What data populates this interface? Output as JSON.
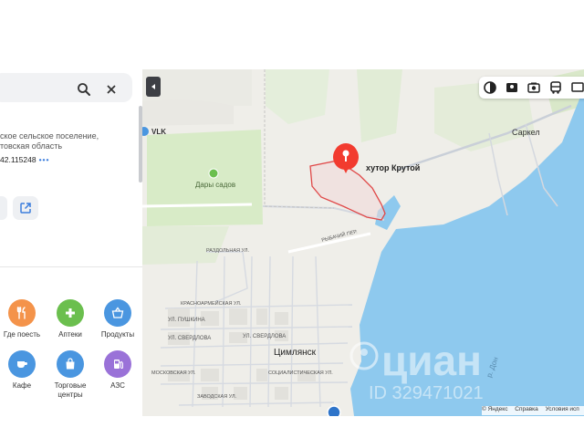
{
  "search": {
    "value": ""
  },
  "place": {
    "address_line1": "ское сельское поселение,",
    "address_line2": "товская область",
    "coords": "42.115248",
    "coords_more": "•••"
  },
  "categories": [
    {
      "label": "Где поесть",
      "icon": "fork-knife-icon",
      "color": "#f4934a"
    },
    {
      "label": "Аптеки",
      "icon": "plus-icon",
      "color": "#6bbf4e"
    },
    {
      "label": "Продукты",
      "icon": "basket-icon",
      "color": "#4a96e0"
    },
    {
      "label": "Кафе",
      "icon": "cup-icon",
      "color": "#4a96e0"
    },
    {
      "label": "Торговые центры",
      "icon": "bag-icon",
      "color": "#4a96e0"
    },
    {
      "label": "АЗС",
      "icon": "fuel-icon",
      "color": "#9a72d8"
    }
  ],
  "map": {
    "marker_label": "хутор Крутой",
    "places": {
      "vlk": "VLK",
      "dary": "Дары садов",
      "sarkel": "Саркел",
      "tsimlyansk": "Цимлянск",
      "don": "р. Дон"
    },
    "streets": {
      "razdolnaya": "РАЗДОЛЬНАЯ УЛ.",
      "rybachy": "РЫБАЧИЙ ПЕР.",
      "krasnoarmeyskaya": "КРАСНОАРМЕЙСКАЯ УЛ.",
      "pushkina": "УЛ. ПУШКИНА",
      "sverdlova": "УЛ. СВЕРДЛОВА",
      "sotsialisticheskaya": "СОЦИАЛИСТИЧЕСКАЯ УЛ.",
      "zavodskaya": "ЗАВОДСКАЯ УЛ.",
      "moskovskaya": "МОСКОВСКАЯ УЛ.",
      "sverdlova2": "УЛ. СВЕРДЛОВА"
    },
    "footer": {
      "copyright": "© Яндекс",
      "help": "Справка",
      "terms": "Условия исп"
    },
    "watermark_text": "циан",
    "watermark_id": "ID 329471021",
    "water_color": "#8ec9ee",
    "park_color": "#d8ebc7",
    "marker_color": "#f23b2f"
  }
}
